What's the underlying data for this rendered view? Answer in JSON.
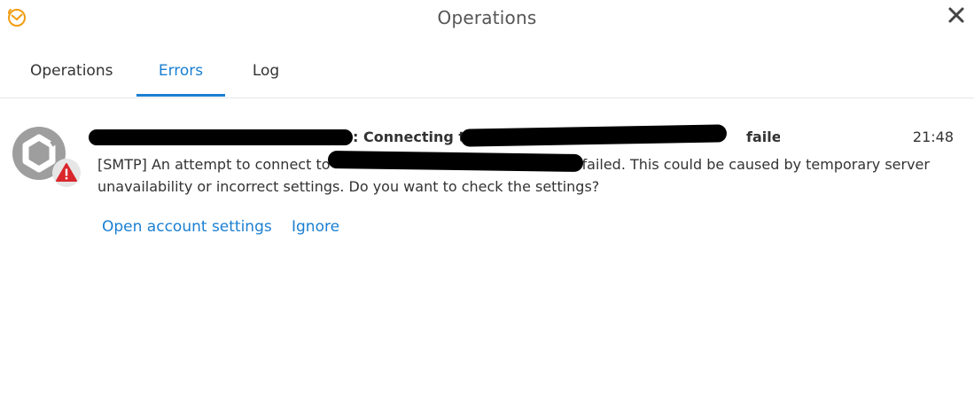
{
  "window": {
    "title": "Operations",
    "close_label": "×"
  },
  "tabs": [
    {
      "label": "Operations",
      "active": false
    },
    {
      "label": "Errors",
      "active": true
    },
    {
      "label": "Log",
      "active": false
    }
  ],
  "error": {
    "title_visible_part": ": Connecting to",
    "title_end": "failed",
    "time": "21:48",
    "message_line1_start": "[SMTP] An attempt to connect to",
    "message_line1_end": "failed. This could be caused by temporary server",
    "message_line2": "unavailability or incorrect settings. Do you want to check the settings?",
    "actions": {
      "open_settings": "Open account settings",
      "ignore": "Ignore"
    }
  },
  "colors": {
    "accent": "#1a7fd1",
    "avatar_gray": "#9e9e9e",
    "warning_red": "#d9262c",
    "app_icon_orange": "#f39c12"
  },
  "icons": {
    "app": "envelope-clock-icon",
    "close": "close-icon",
    "avatar": "hexagon-account-icon",
    "badge": "warning-triangle-icon"
  }
}
